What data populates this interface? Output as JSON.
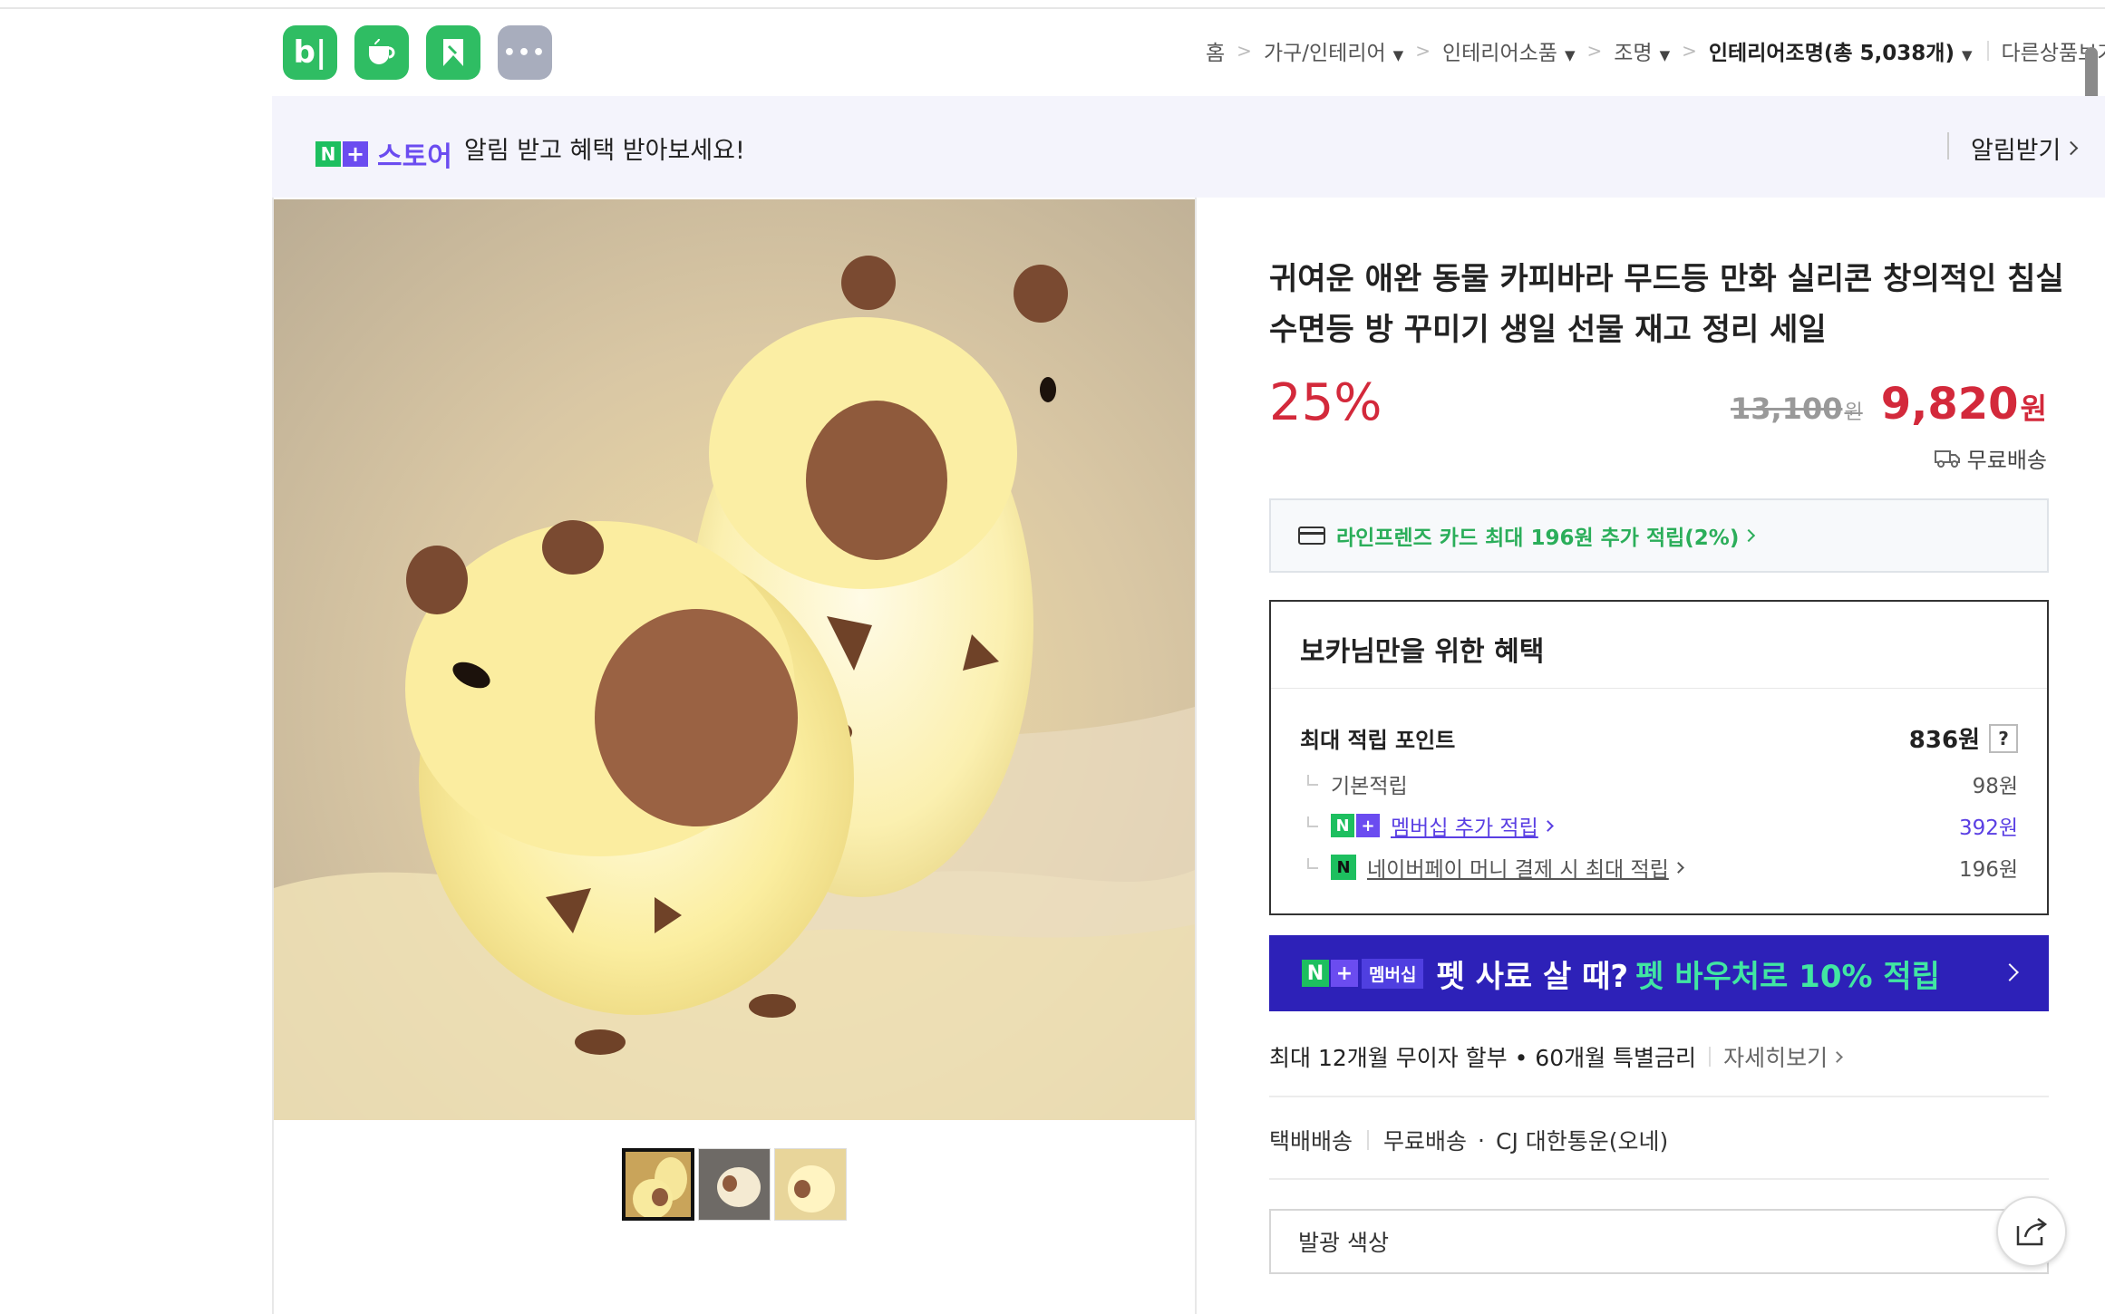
{
  "apps": [
    {
      "name": "blog-app-icon",
      "glyph": "b|",
      "color": "#2fbd63"
    },
    {
      "name": "cafe-app-icon",
      "glyph": "",
      "color": "#2fbd63"
    },
    {
      "name": "bookmark-app-icon",
      "glyph": "",
      "color": "#2fbd63"
    },
    {
      "name": "more-apps-icon",
      "glyph": "•••",
      "color": "#a8adbd"
    }
  ],
  "breadcrumb": {
    "home": "홈",
    "items": [
      "가구/인테리어",
      "인테리어소품",
      "조명"
    ],
    "current": "인테리어조명(총 5,038개)",
    "other": "다른상품보기"
  },
  "banner": {
    "store_label": "스토어",
    "text": "알림 받고 혜택 받아보세요!",
    "action": "알림받기"
  },
  "product": {
    "title_line1": "귀여운 애완 동물 카피바라 무드등 만화 실리콘 창의적인 침실",
    "title_line2": "수면등 방 꾸미기 생일 선물 재고 정리 세일",
    "discount": "25%",
    "original_price": "13,100",
    "price": "9,820",
    "currency": "원",
    "shipping": "무료배송"
  },
  "card_offer": {
    "text": "라인프렌즈 카드 최대 196원 추가 적립(2%)"
  },
  "benefits": {
    "title": "보카님만을 위한 혜택",
    "max_points_label": "최대 적립 포인트",
    "max_points_value": "836원",
    "help": "?",
    "rows": [
      {
        "label": "기본적립",
        "value": "98원"
      },
      {
        "label": "멤버십 추가 적립",
        "value": "392원"
      },
      {
        "label": "네이버페이 머니 결제 시 최대 적립",
        "value": "196원"
      }
    ]
  },
  "promo": {
    "membership": "멤버십",
    "question": "펫 사료 살 때?",
    "highlight": "펫 바우처로 10% 적립"
  },
  "installment": {
    "text": "최대 12개월 무이자 할부 • 60개월 특별금리",
    "more": "자세히보기"
  },
  "delivery": {
    "type": "택배배송",
    "fee": "무료배송",
    "carrier": "CJ 대한통운(오네)"
  },
  "option": {
    "label": "발광 색상"
  },
  "colors": {
    "brand_green": "#1dbf5f",
    "brand_purple": "#6b4cf0",
    "price_red": "#d3293b",
    "promo_bg": "#2d21b8",
    "promo_highlight": "#41e6a2"
  }
}
